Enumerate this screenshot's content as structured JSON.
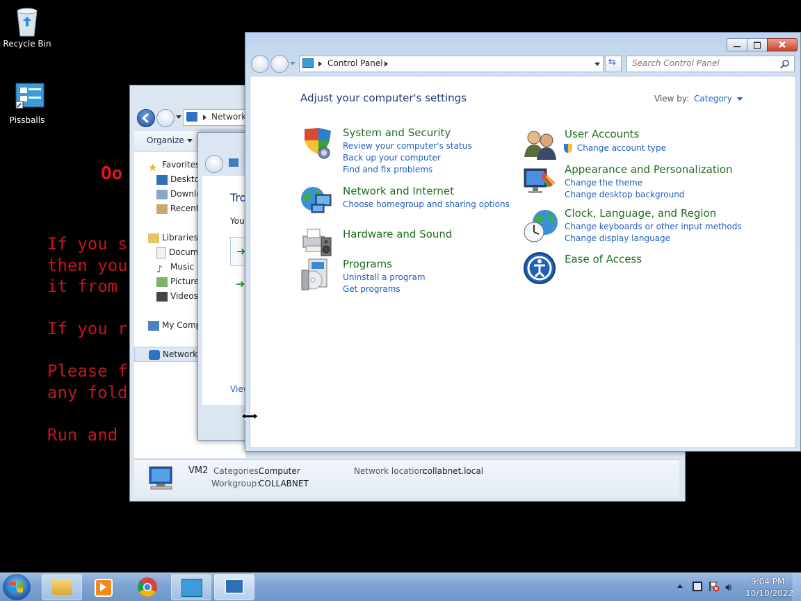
{
  "desktop": {
    "icons": [
      {
        "label": "Recycle Bin",
        "icon": "recycle-bin-icon"
      },
      {
        "label": "Pissballs",
        "icon": "control-panel-shortcut-icon"
      }
    ],
    "wallpaper": {
      "title": "Oo",
      "lines": [
        "If you s",
        "then you",
        "it from",
        "",
        "If you r",
        "",
        "Please f",
        "any fold",
        "",
        "Run and"
      ],
      "color": "#c8141c"
    }
  },
  "explorer": {
    "address": "Network",
    "toolbar": {
      "organize": "Organize"
    },
    "nav": {
      "favorites": "Favorites",
      "desktop": "Desktop",
      "downloads": "Downlo",
      "recent": "Recent",
      "libraries": "Libraries",
      "documents": "Docum",
      "music": "Music",
      "pictures": "Pictures",
      "videos": "Videos",
      "my_computer": "My Comp",
      "network": "Network"
    },
    "details": {
      "name": "VM2",
      "categories_label": "Categories:",
      "categories_value": "Computer",
      "workgroup_label": "Workgroup:",
      "workgroup_value": "COLLABNET",
      "netloc_label": "Network location:",
      "netloc_value": "collabnet.local"
    }
  },
  "troubleshoot": {
    "title_fragment": "Tro",
    "subtitle_fragment": "You",
    "view_link": "View"
  },
  "control_panel": {
    "breadcrumb": "Control Panel",
    "search_placeholder": "Search Control Panel",
    "heading": "Adjust your computer's settings",
    "view_by_label": "View by:",
    "view_by_value": "Category",
    "categories_left": [
      {
        "title": "System and Security",
        "icon": "shield-icon",
        "links": [
          "Review your computer's status",
          "Back up your computer",
          "Find and fix problems"
        ]
      },
      {
        "title": "Network and Internet",
        "icon": "network-globe-icon",
        "links": [
          "Choose homegroup and sharing options"
        ]
      },
      {
        "title": "Hardware and Sound",
        "icon": "printer-speaker-icon",
        "links": []
      },
      {
        "title": "Programs",
        "icon": "programs-disc-icon",
        "links": [
          "Uninstall a program",
          "Get programs"
        ]
      }
    ],
    "categories_right": [
      {
        "title": "User Accounts",
        "icon": "users-icon",
        "links": [
          "Change account type"
        ]
      },
      {
        "title": "Appearance and Personalization",
        "icon": "monitor-paint-icon",
        "links": [
          "Change the theme",
          "Change desktop background"
        ]
      },
      {
        "title": "Clock, Language, and Region",
        "icon": "clock-globe-icon",
        "links": [
          "Change keyboards or other input methods",
          "Change display language"
        ]
      },
      {
        "title": "Ease of Access",
        "icon": "ease-of-access-icon",
        "links": []
      }
    ]
  },
  "taskbar": {
    "time": "9:04 PM",
    "date": "10/10/2022"
  }
}
